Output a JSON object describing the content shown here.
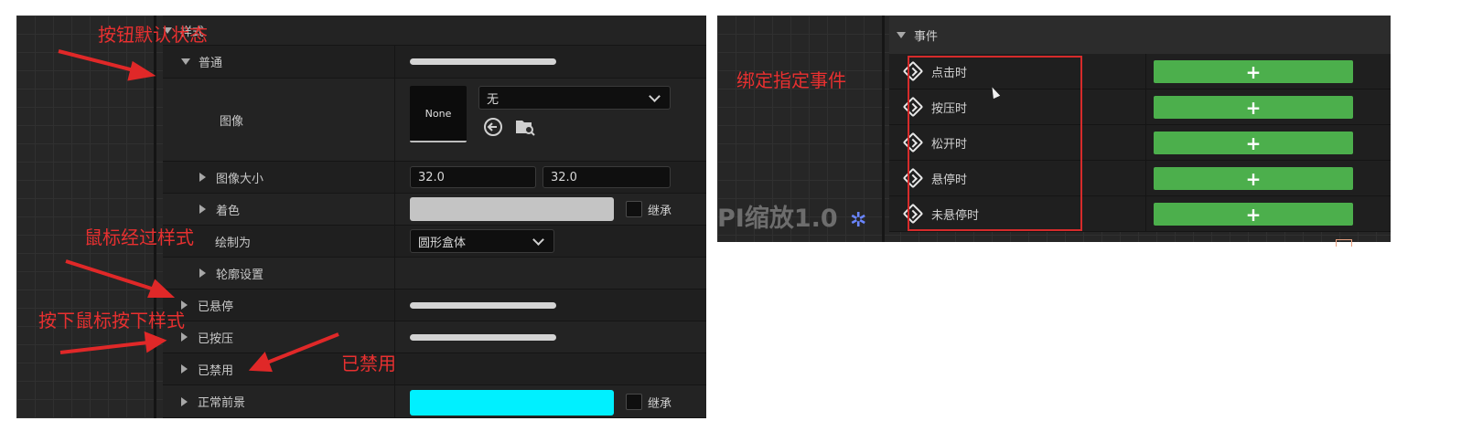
{
  "left_panel": {
    "section_style": "样式",
    "normal": "普通",
    "image_label": "图像",
    "image_thumb_text": "None",
    "image_dropdown_value": "无",
    "image_size_label": "图像大小",
    "image_size_x": "32.0",
    "image_size_y": "32.0",
    "tint_label": "着色",
    "inherit_label": "继承",
    "draw_as_label": "绘制为",
    "draw_as_value": "圆形盒体",
    "outline_label": "轮廓设置",
    "hovered_label": "已悬停",
    "pressed_label": "已按压",
    "disabled_label": "已禁用",
    "normal_fg_label": "正常前景",
    "colors": {
      "tint": "#c4c4c4",
      "normal_fg": "#00f0ff"
    }
  },
  "annotations": {
    "default_state": "按钮默认状态",
    "hover_style": "鼠标经过样式",
    "press_style": "按下鼠标按下样式",
    "disabled": "已禁用",
    "bind_event": "绑定指定事件"
  },
  "right_panel": {
    "section_events": "事件",
    "dpi_text": "PI缩放1.0",
    "events": [
      {
        "label": "点击时",
        "button": "+"
      },
      {
        "label": "按压时",
        "button": "+"
      },
      {
        "label": "松开时",
        "button": "+"
      },
      {
        "label": "悬停时",
        "button": "+"
      },
      {
        "label": "未悬停时",
        "button": "+"
      }
    ]
  }
}
